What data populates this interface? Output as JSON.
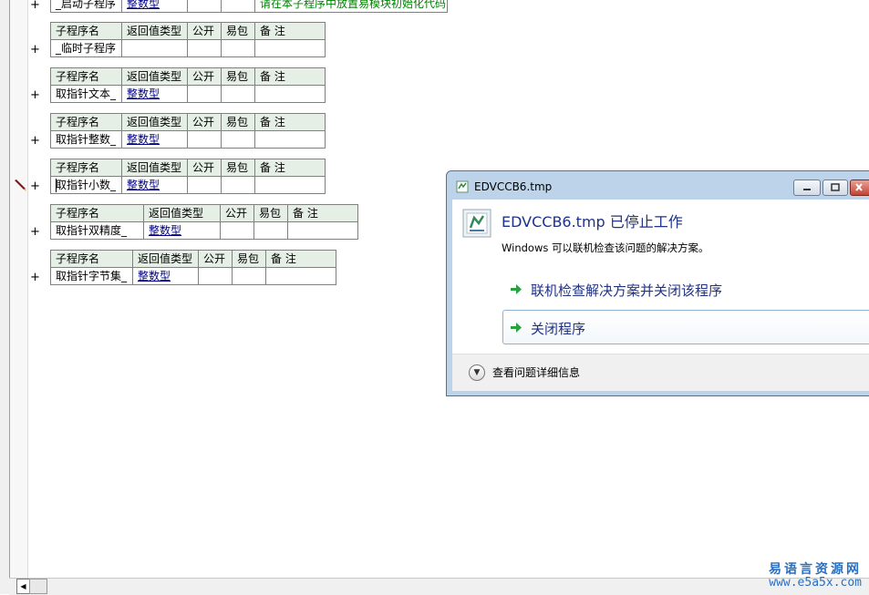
{
  "editor": {
    "headers": {
      "name": "子程序名",
      "return_type": "返回值类型",
      "public": "公开",
      "easy_pack": "易包",
      "note": "备 注"
    },
    "plus_symbol": "+",
    "subroutines": [
      {
        "name": "_启动子程序",
        "return_type": "整数型",
        "note": "请在本子程序中放置易模块初始化代码"
      },
      {
        "name": "_临时子程序",
        "return_type": "",
        "note": ""
      },
      {
        "name": "取指针文本_",
        "return_type": "整数型",
        "note": ""
      },
      {
        "name": "取指针整数_",
        "return_type": "整数型",
        "note": ""
      },
      {
        "name": "取指针小数_",
        "return_type": "整数型",
        "note": ""
      },
      {
        "name": "取指针双精度_",
        "return_type": "整数型",
        "note": ""
      },
      {
        "name": "取指针字节集_",
        "return_type": "整数型",
        "note": ""
      }
    ]
  },
  "dialog": {
    "title": "EDVCCB6.tmp",
    "heading": "EDVCCB6.tmp 已停止工作",
    "description": "Windows 可以联机检查该问题的解决方案。",
    "option_online": "联机检查解决方案并关闭该程序",
    "option_close": "关闭程序",
    "details": "查看问题详细信息"
  },
  "watermark": {
    "line1": "易语言资源网",
    "line2": "www.e5a5x.com"
  },
  "colors": {
    "header_bg": "#e6efe6",
    "type_link": "#000080",
    "note_green": "#008000",
    "dialog_heading": "#1e3287",
    "arrow_green": "#2aa040"
  }
}
